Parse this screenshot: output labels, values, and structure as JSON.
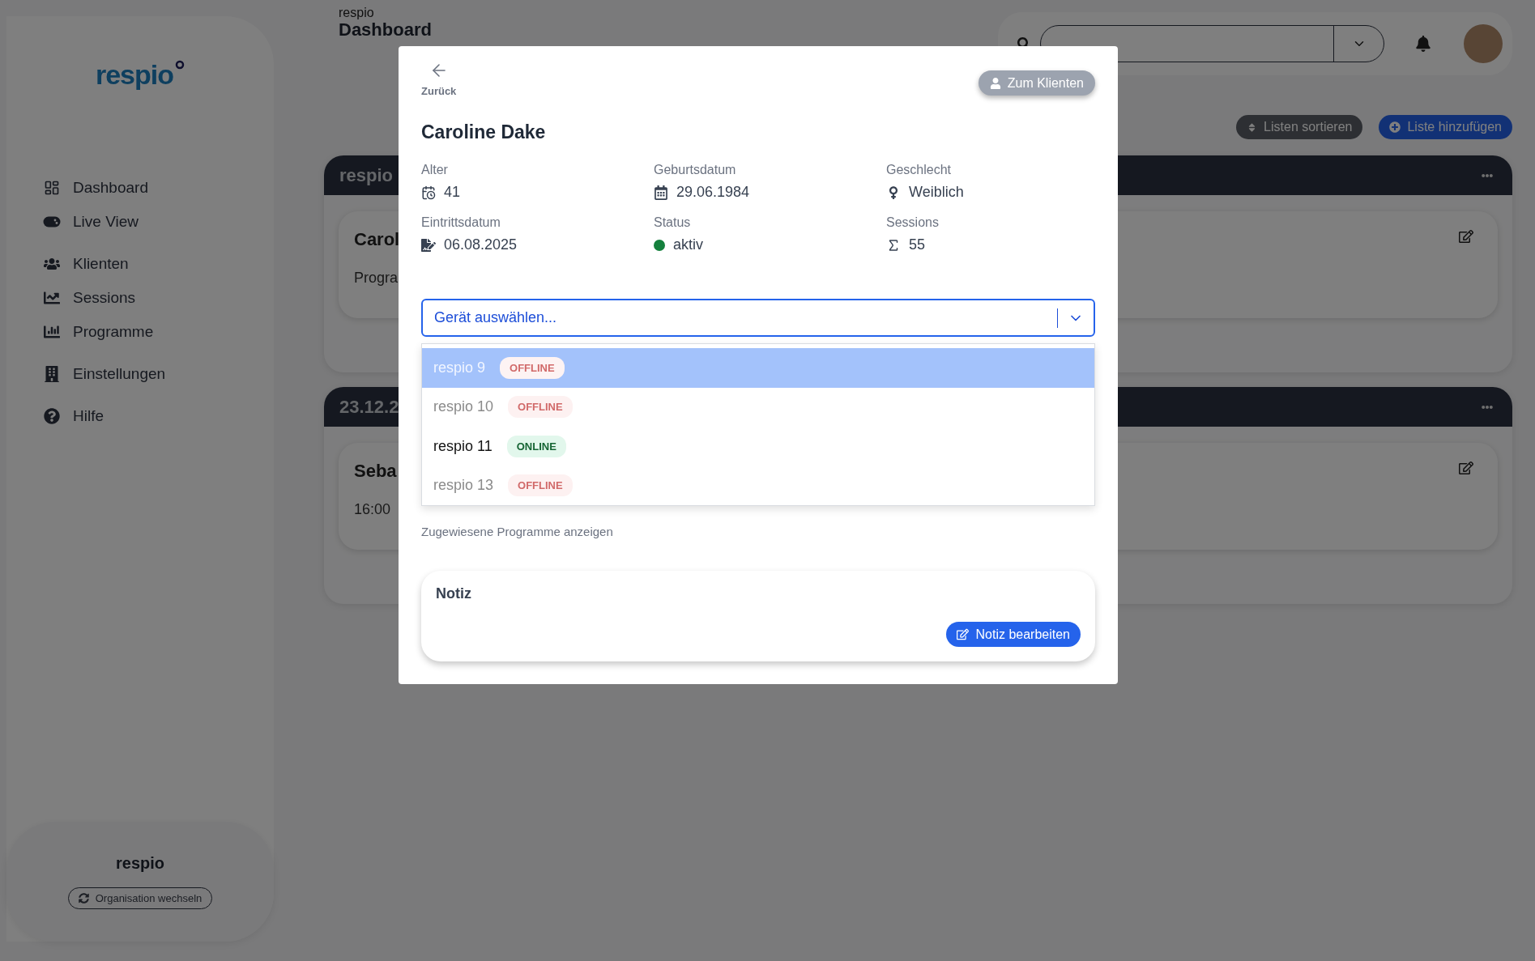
{
  "sidebar": {
    "logo": "respio",
    "nav_groups": [
      [
        {
          "label": "Dashboard"
        },
        {
          "label": "Live View"
        }
      ],
      [
        {
          "label": "Klienten"
        },
        {
          "label": "Sessions"
        },
        {
          "label": "Programme"
        }
      ],
      [
        {
          "label": "Einstellungen"
        }
      ],
      [
        {
          "label": "Hilfe"
        }
      ]
    ],
    "organisation": {
      "name": "respio",
      "switch_button": "Organisation wechseln"
    }
  },
  "header": {
    "breadcrumb": "respio",
    "title": "Dashboard"
  },
  "toolbar": {
    "sort_button": "Listen sortieren",
    "add_button": "Liste hinzufügen"
  },
  "lists": [
    {
      "title": "respio",
      "card_title": "Carol",
      "card_text": "Progra"
    },
    {
      "title": "23.12.2",
      "card_title": "Seba",
      "card_text": "16:00"
    }
  ],
  "modal": {
    "back_label": "Zurück",
    "client_button": "Zum Klienten",
    "name": "Caroline Dake",
    "fields": [
      {
        "label": "Alter",
        "value": "41"
      },
      {
        "label": "Geburtsdatum",
        "value": "29.06.1984"
      },
      {
        "label": "Geschlecht",
        "value": "Weiblich"
      },
      {
        "label": "Eintrittsdatum",
        "value": "06.08.2025"
      },
      {
        "label": "Status",
        "value": "aktiv",
        "active": true
      },
      {
        "label": "Sessions",
        "value": "55"
      }
    ],
    "device_select": {
      "placeholder": "Gerät auswählen...",
      "expanded": true,
      "options": [
        {
          "name": "respio 9",
          "status": "OFFLINE",
          "online": false,
          "selected": true
        },
        {
          "name": "respio 10",
          "status": "OFFLINE",
          "online": false,
          "selected": false
        },
        {
          "name": "respio 11",
          "status": "ONLINE",
          "online": true,
          "selected": false
        },
        {
          "name": "respio 13",
          "status": "OFFLINE",
          "online": false,
          "selected": false
        }
      ]
    },
    "programs_link": "Zugewiesene Programme anzeigen",
    "note": {
      "title": "Notiz",
      "edit_button": "Notiz bearbeiten"
    }
  }
}
